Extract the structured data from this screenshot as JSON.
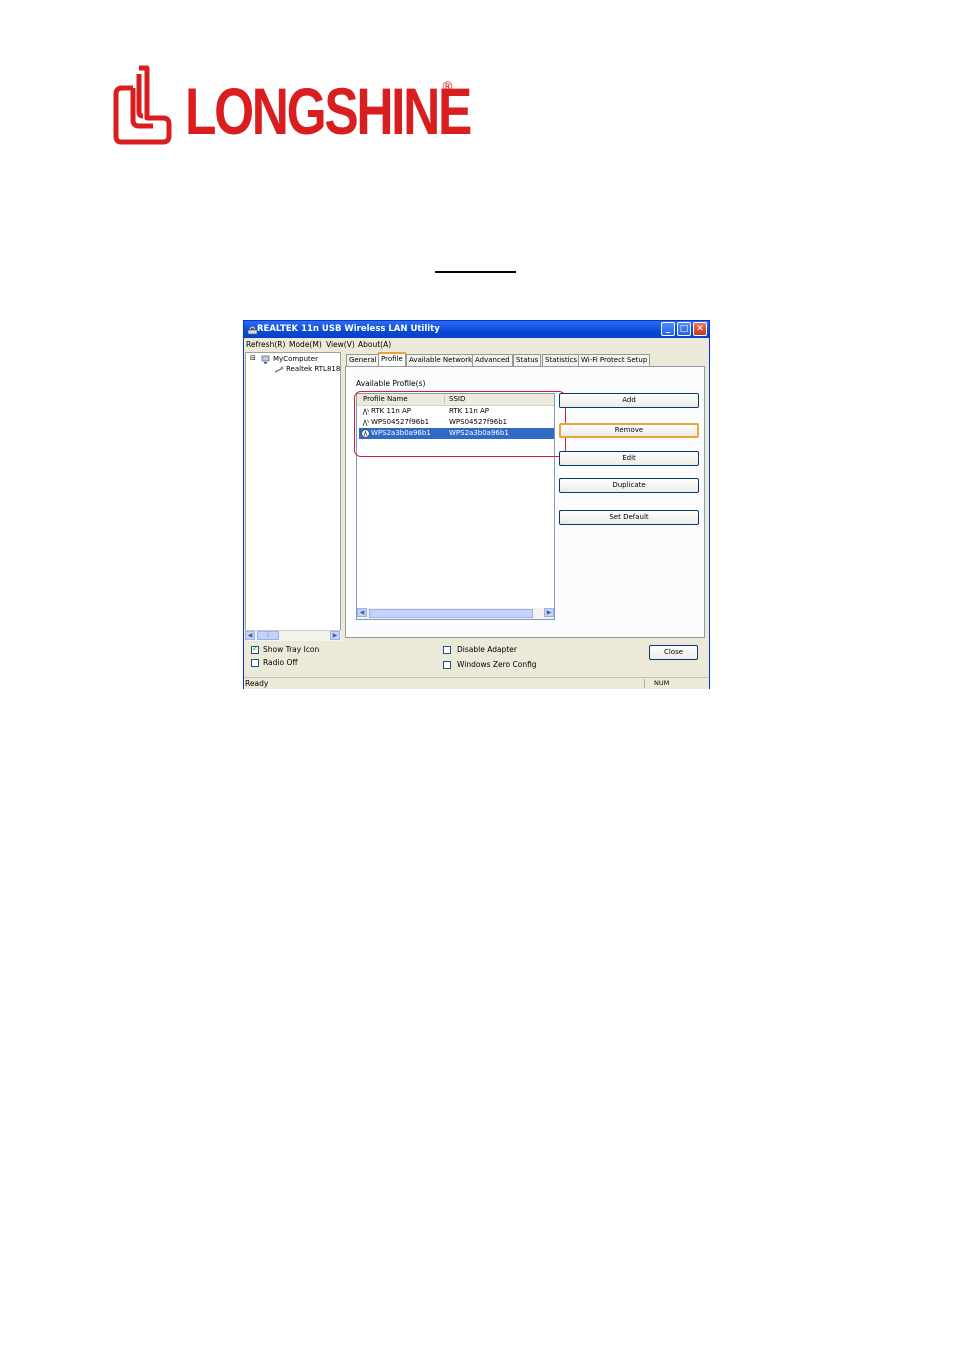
{
  "logo": {
    "brand": "LONGSHINE",
    "registered": "®",
    "color": "#d81e1e"
  },
  "window": {
    "title": "REALTEK 11n USB Wireless LAN Utility",
    "menu": [
      "Refresh(R)",
      "Mode(M)",
      "View(V)",
      "About(A)"
    ],
    "tree": {
      "root": "MyComputer",
      "child": "Realtek RTL818"
    },
    "tabs": [
      "General",
      "Profile",
      "Available Network",
      "Advanced",
      "Status",
      "Statistics",
      "Wi-Fi Protect Setup"
    ],
    "active_tab": "Profile",
    "profile": {
      "label": "Available Profile(s)",
      "columns": [
        "Profile Name",
        "SSID"
      ],
      "rows": [
        {
          "name": "RTK 11n AP",
          "ssid": "RTK 11n AP",
          "selected": false
        },
        {
          "name": "WPS04527f96b1",
          "ssid": "WPS04527f96b1",
          "selected": false
        },
        {
          "name": "WPS2a3b0a96b1",
          "ssid": "WPS2a3b0a96b1",
          "selected": true
        }
      ],
      "buttons": [
        "Add",
        "Remove",
        "Edit",
        "Duplicate",
        "Set Default"
      ],
      "focused_button": "Remove"
    },
    "options": {
      "show_tray_icon": {
        "label": "Show Tray Icon",
        "checked": true
      },
      "radio_off": {
        "label": "Radio Off",
        "checked": false
      },
      "disable_adapter": {
        "label": "Disable Adapter",
        "checked": false
      },
      "windows_zero_config": {
        "label": "Windows Zero Config",
        "checked": false
      }
    },
    "close_label": "Close",
    "status": {
      "text": "Ready",
      "num": "NUM"
    },
    "selection_color": "#316ac5",
    "highlight_outline_color": "#d41d33"
  }
}
